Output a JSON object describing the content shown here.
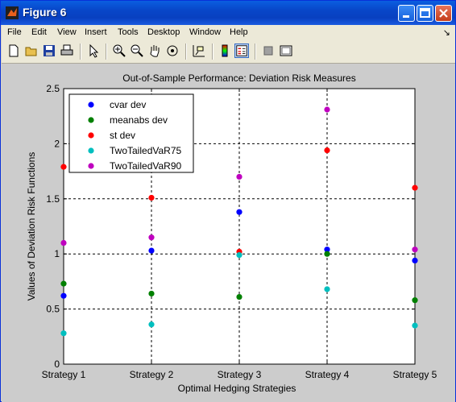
{
  "window": {
    "title": "Figure 6"
  },
  "menu": [
    "File",
    "Edit",
    "View",
    "Insert",
    "Tools",
    "Desktop",
    "Window",
    "Help"
  ],
  "menu_extra": "↘",
  "toolbar_icons": [
    "new-file-icon",
    "open-folder-icon",
    "save-icon",
    "print-icon",
    "arrow-pointer-icon",
    "zoom-in-icon",
    "zoom-out-icon",
    "pan-hand-icon",
    "rotate-3d-icon",
    "data-cursor-icon",
    "colorbar-icon",
    "legend-icon",
    "hide-plot-tools-icon",
    "show-plot-tools-icon"
  ],
  "chart_data": {
    "type": "scatter",
    "title": "Out-of-Sample Performance: Deviation Risk Measures",
    "xlabel": "Optimal Hedging Strategies",
    "ylabel": "Values of Deviation Risk Functions",
    "categories": [
      "Strategy 1",
      "Strategy 2",
      "Strategy 3",
      "Strategy 4",
      "Strategy 5"
    ],
    "ylim": [
      0,
      2.5
    ],
    "yticks": [
      "0",
      "0.5",
      "1",
      "1.5",
      "2",
      "2.5"
    ],
    "grid": true,
    "legend_position": "top-left",
    "series": [
      {
        "name": "cvar dev",
        "color": "#0000ff",
        "values": [
          0.62,
          1.03,
          1.38,
          1.04,
          0.94
        ]
      },
      {
        "name": "meanabs dev",
        "color": "#008000",
        "values": [
          0.73,
          0.64,
          0.61,
          1.0,
          0.58
        ]
      },
      {
        "name": "st dev",
        "color": "#ff0000",
        "values": [
          1.79,
          1.51,
          1.02,
          1.94,
          1.6
        ]
      },
      {
        "name": "TwoTailedVaR75",
        "color": "#00bfbf",
        "values": [
          0.28,
          0.36,
          0.99,
          0.68,
          0.35
        ]
      },
      {
        "name": "TwoTailedVaR90",
        "color": "#bf00bf",
        "values": [
          1.1,
          1.15,
          1.7,
          2.31,
          1.04
        ]
      }
    ]
  }
}
